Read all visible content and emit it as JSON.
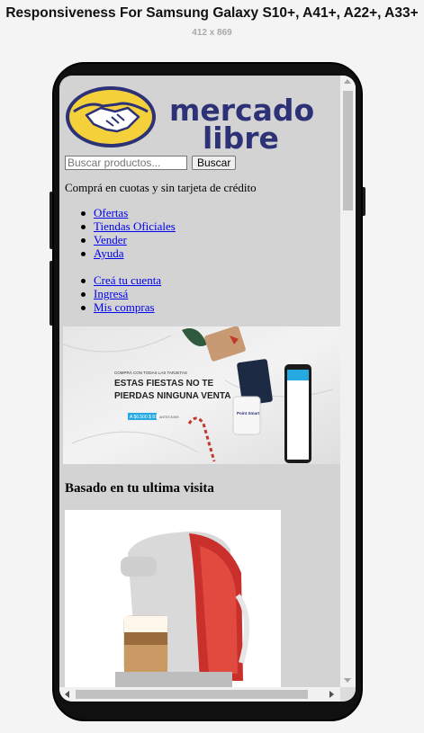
{
  "header": {
    "title": "Responsiveness For Samsung Galaxy S10+, A41+, A22+, A33+",
    "resolution": "412 x 869"
  },
  "site": {
    "logo_text_line1": "mercado",
    "logo_text_line2": "libre",
    "search": {
      "placeholder": "Buscar productos...",
      "button_label": "Buscar"
    },
    "promo_text": "Comprá en cuotas y sin tarjeta de crédito",
    "nav_primary": [
      "Ofertas",
      "Tiendas Oficiales",
      "Vender",
      "Ayuda"
    ],
    "nav_account": [
      "Creá tu cuenta",
      "Ingresá",
      "Mis compras"
    ],
    "banner": {
      "small_text": "COMPRÁ CON TODAS LAS TARJETAS",
      "headline_line1": "ESTAS FIESTAS NO TE",
      "headline_line2": "PIERDAS NINGUNA VENTA",
      "price_tag": "A $6.500 $ 810",
      "price_note": "ANTES $ 899",
      "brand_label": "Point Smart"
    },
    "section_title": "Basado en tu ultima visita"
  },
  "colors": {
    "brand_blue": "#2d3277",
    "brand_yellow": "#f4d13a",
    "link": "#0000ee",
    "page_bg": "#d3d3d3"
  },
  "icons": {
    "scroll_up": "triangle-up-icon",
    "scroll_down": "triangle-down-icon",
    "scroll_left": "triangle-left-icon",
    "scroll_right": "triangle-right-icon"
  }
}
